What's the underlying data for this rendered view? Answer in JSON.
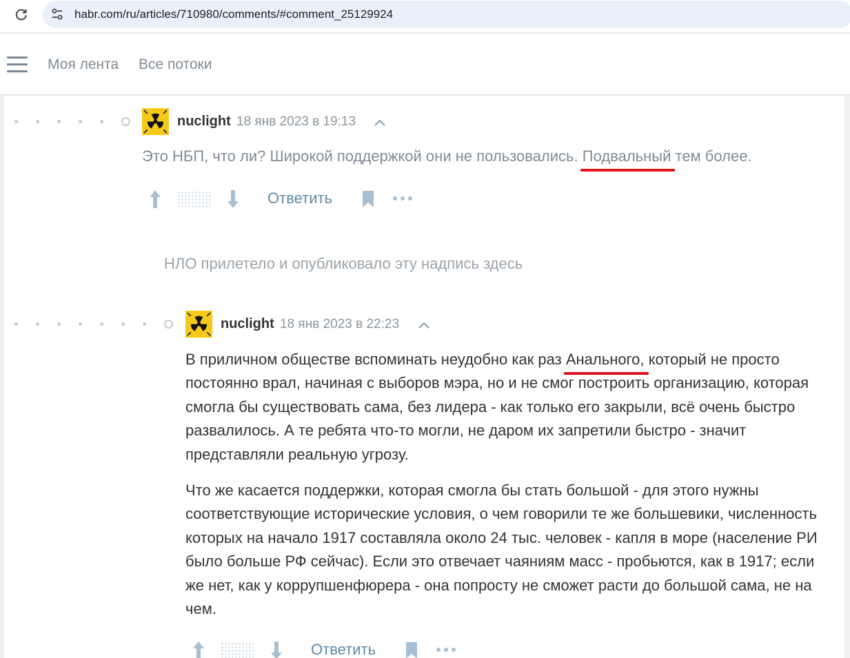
{
  "browser": {
    "url": "habr.com/ru/articles/710980/comments/#comment_25129924"
  },
  "header": {
    "nav": [
      {
        "label": "Моя лента"
      },
      {
        "label": "Все потоки"
      }
    ]
  },
  "comments": [
    {
      "author": "nuclight",
      "date": "18 янв 2023 в 19:13",
      "text_before": "Это НБП, что ли? Широкой поддержкой они не пользовались. ",
      "text_underlined": "Подвальный",
      "text_after": " тем более.",
      "reply_label": "Ответить"
    },
    {
      "author": "nuclight",
      "date": "18 янв 2023 в 22:23",
      "p1_before": "В приличном обществе вспоминать неудобно как раз ",
      "p1_underlined": "Анального,",
      "p1_after": " который не просто постоянно врал, начиная с выборов мэра, но и не смог построить организацию, которая смогла бы существовать сама, без лидера - как только его закрыли, всё очень быстро развалилось. А те ребята что-то могли, не даром их запретили быстро - значит представляли реальную угрозу.",
      "p2": "Что же касается поддержки, которая смогла бы стать большой - для этого нужны соответствующие исторические условия, о чем говорили те же большевики, численность которых на начало 1917 составляла около 24 тыс. человек - капля в море (население РИ было больше РФ сейчас). Если это отвечает чаяниям масс - пробьются, как в 1917; если же нет, как у коррупшенфюрера - она попросту не сможет расти до большой сама, не на чем.",
      "reply_label": "Ответить"
    }
  ],
  "ufo_note": "НЛО прилетело и опубликовало эту надпись здесь",
  "icons": {
    "reload": "reload-icon",
    "site_settings": "tune-icon",
    "menu": "burger-menu-icon",
    "avatar": "radiation-avatar",
    "collapse": "chevron-up-icon",
    "upvote": "arrow-up-icon",
    "downvote": "arrow-down-icon",
    "bookmark": "bookmark-icon",
    "more": "more-dots-icon"
  },
  "colors": {
    "accent_link": "#5e8aa8",
    "underline_mark": "#e0141e",
    "avatar_yellow": "#f6c81a"
  }
}
